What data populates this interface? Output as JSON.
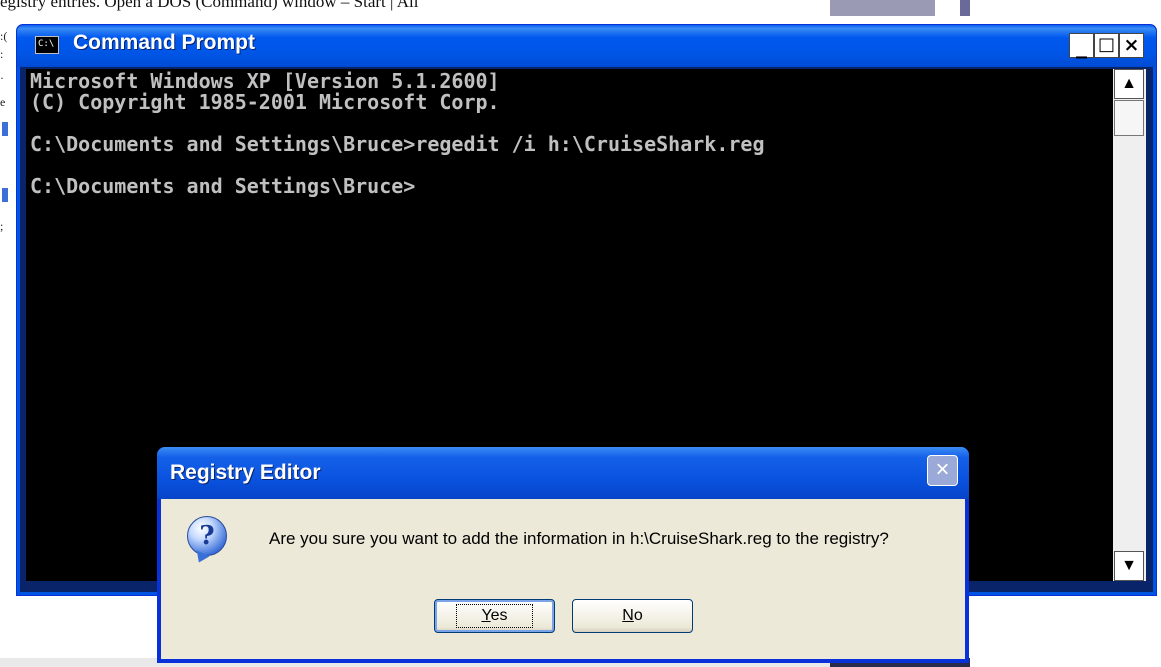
{
  "background": {
    "doc_text": "egistry entries. Open a DOS (Command) window – Start | All",
    "left_margin_chars": [
      ":(",
      ":",
      "·",
      "e",
      "",
      "",
      "",
      "",
      ";"
    ]
  },
  "console_window": {
    "title": "Command Prompt",
    "icon_label": "C:\\",
    "controls": {
      "minimize": "_",
      "maximize": "□",
      "close": "×"
    },
    "lines": [
      "Microsoft Windows XP [Version 5.1.2600]",
      "(C) Copyright 1985-2001 Microsoft Corp.",
      "",
      "C:\\Documents and Settings\\Bruce>regedit /i h:\\CruiseShark.reg",
      "",
      "C:\\Documents and Settings\\Bruce>"
    ],
    "scrollbar": {
      "up": "▲",
      "down": "▼"
    }
  },
  "dialog": {
    "title": "Registry Editor",
    "close_symbol": "×",
    "icon": "question-icon",
    "icon_glyph": "?",
    "message": "Are you sure you want to add the information in h:\\CruiseShark.reg to the registry?",
    "yes": {
      "access_key": "Y",
      "rest": "es"
    },
    "no": {
      "access_key": "N",
      "rest": "o"
    }
  }
}
